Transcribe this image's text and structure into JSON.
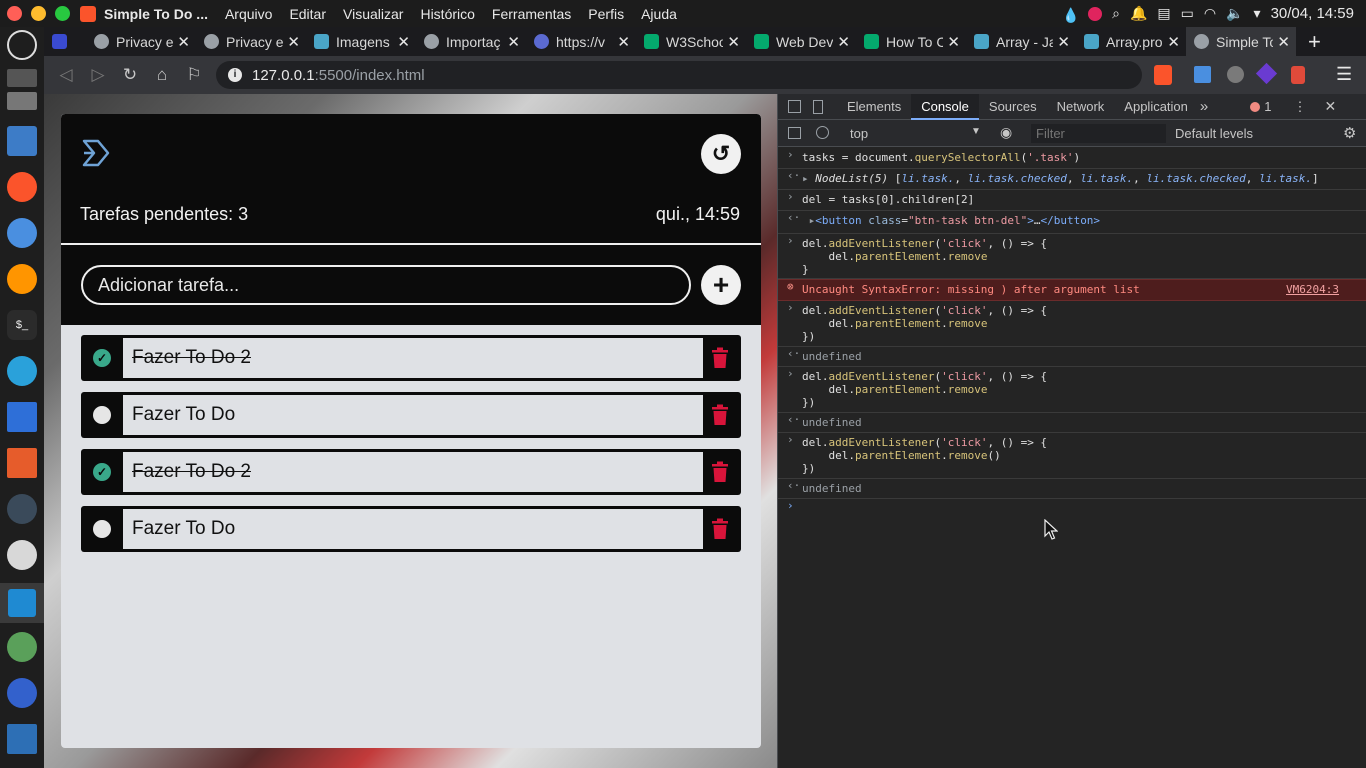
{
  "os": {
    "app_title": "Simple To Do ...",
    "menu": [
      "Arquivo",
      "Editar",
      "Visualizar",
      "Histórico",
      "Ferramentas",
      "Perfis",
      "Ajuda"
    ],
    "datetime": "30/04, 14:59",
    "traffic_colors": [
      "#ff5f57",
      "#febc2e",
      "#28c840"
    ]
  },
  "browser": {
    "tabs": [
      {
        "label": "",
        "icon": "discord-icon",
        "color": "#5865f2",
        "closable": false
      },
      {
        "label": "Privacy e",
        "icon": "globe-icon",
        "color": "#9aa0a6",
        "closable": true
      },
      {
        "label": "Privacy e",
        "icon": "globe-icon",
        "color": "#9aa0a6",
        "closable": true
      },
      {
        "label": "Imagens",
        "icon": "github-icon",
        "color": "#4aa5c7",
        "closable": true
      },
      {
        "label": "Importaç",
        "icon": "globe-icon",
        "color": "#9aa0a6",
        "closable": true
      },
      {
        "label": "https://v",
        "icon": "lambda-icon",
        "color": "#8ab4f8",
        "closable": true
      },
      {
        "label": "W3Schoo",
        "icon": "w3-icon",
        "color": "#04aa6d",
        "closable": true
      },
      {
        "label": "Web Dev",
        "icon": "w3-icon",
        "color": "#04aa6d",
        "closable": true
      },
      {
        "label": "How To C",
        "icon": "w3-icon",
        "color": "#04aa6d",
        "closable": true
      },
      {
        "label": "Array - Ja",
        "icon": "mdn-icon",
        "color": "#4aa5c7",
        "closable": true
      },
      {
        "label": "Array.pro",
        "icon": "mdn-icon",
        "color": "#4aa5c7",
        "closable": true
      },
      {
        "label": "Simple To",
        "icon": "globe-icon",
        "color": "#9aa0a6",
        "closable": true,
        "active": true
      }
    ],
    "new_tab": "+",
    "url_host": "127.0.0.1",
    "url_rest": ":5500/index.html"
  },
  "app": {
    "pending_label": "Tarefas pendentes: 3",
    "clock": "qui., 14:59",
    "input_placeholder": "Adicionar tarefa...",
    "add_symbol": "+",
    "tasks": [
      {
        "text": "Fazer To Do 2",
        "checked": true
      },
      {
        "text": "Fazer To Do",
        "checked": false
      },
      {
        "text": "Fazer To Do 2",
        "checked": true
      },
      {
        "text": "Fazer To Do",
        "checked": false
      }
    ]
  },
  "devtools": {
    "tabs": [
      "Elements",
      "Console",
      "Sources",
      "Network",
      "Application"
    ],
    "active_tab": "Console",
    "error_count": "1",
    "context": "top",
    "filter_placeholder": "Filter",
    "levels": "Default levels",
    "error_message": "Uncaught SyntaxError: missing ) after argument list",
    "error_source": "VM6204:3",
    "undefined": "undefined"
  }
}
